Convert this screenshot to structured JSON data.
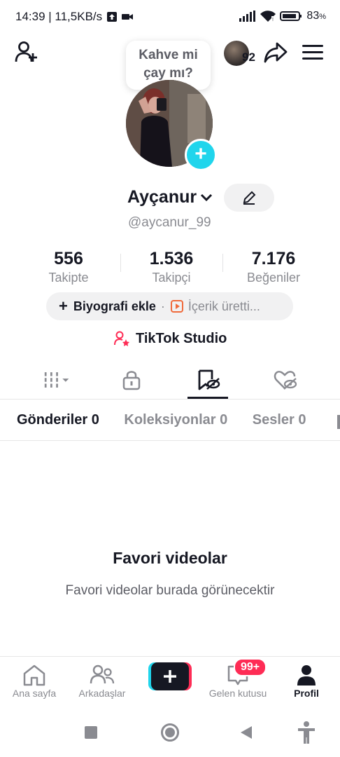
{
  "status_bar": {
    "time_speed": "14:39 | 11,5KB/s",
    "battery": "83"
  },
  "header": {
    "speech_bubble": "Kahve mi\nçay mı?",
    "friends_count": "92"
  },
  "profile": {
    "name": "Ayçanur",
    "handle": "@aycanur_99",
    "stats": [
      {
        "value": "556",
        "label": "Takipte"
      },
      {
        "value": "1.536",
        "label": "Takipçi"
      },
      {
        "value": "7.176",
        "label": "Beğeniler"
      }
    ],
    "bio_add": "Biyografi ekle",
    "separator": "·",
    "content_hint": "İçerik üretti...",
    "studio": "TikTok Studio"
  },
  "subtabs": [
    {
      "label": "Gönderiler 0"
    },
    {
      "label": "Koleksiyonlar 0"
    },
    {
      "label": "Sesler 0"
    }
  ],
  "empty": {
    "title": "Favori videolar",
    "subtitle": "Favori videolar burada görünecektir"
  },
  "nav": {
    "home": "Ana sayfa",
    "friends": "Arkadaşlar",
    "inbox": "Gelen kutusu",
    "inbox_badge": "99+",
    "profile": "Profil"
  },
  "colors": {
    "accent_cyan": "#20d5ec",
    "accent_red": "#fe2c55",
    "text": "#161823",
    "muted": "#8a8b91"
  }
}
